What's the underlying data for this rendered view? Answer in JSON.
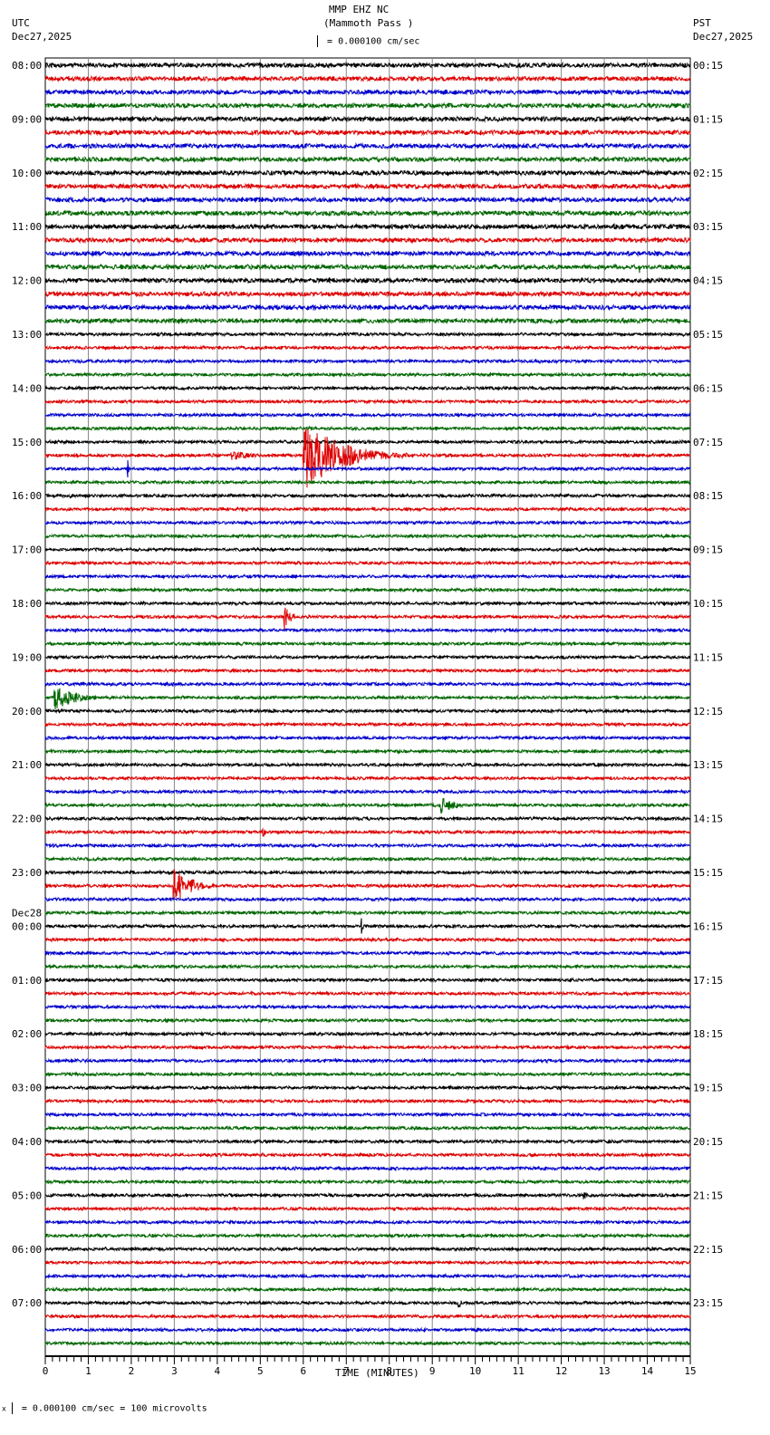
{
  "header": {
    "title": "MMP EHZ NC",
    "subtitle": "(Mammoth Pass )",
    "left_tz": "UTC",
    "left_date": "Dec27,2025",
    "right_tz": "PST",
    "right_date": "Dec27,2025",
    "scale_text": "= 0.000100 cm/sec"
  },
  "footer": {
    "scale_text": "= 0.000100 cm/sec =     100 microvolts"
  },
  "chart_data": {
    "type": "line",
    "title": "MMP EHZ NC (Mammoth Pass )",
    "xlabel": "TIME (MINUTES)",
    "xlim": [
      0,
      15
    ],
    "x_ticks": [
      "0",
      "1",
      "2",
      "3",
      "4",
      "5",
      "6",
      "7",
      "8",
      "9",
      "10",
      "11",
      "12",
      "13",
      "14",
      "15"
    ],
    "trace_count": 96,
    "minutes_per_trace": 15,
    "trace_colors": [
      "#000000",
      "#dd0000",
      "#0000cc",
      "#006600"
    ],
    "left_labels": [
      "08:00",
      "09:00",
      "10:00",
      "11:00",
      "12:00",
      "13:00",
      "14:00",
      "15:00",
      "16:00",
      "17:00",
      "18:00",
      "19:00",
      "20:00",
      "21:00",
      "22:00",
      "23:00",
      "00:00",
      "01:00",
      "02:00",
      "03:00",
      "04:00",
      "05:00",
      "06:00",
      "07:00"
    ],
    "date_change_label": "Dec28",
    "right_labels": [
      "00:15",
      "01:15",
      "02:15",
      "03:15",
      "04:15",
      "05:15",
      "06:15",
      "07:15",
      "08:15",
      "09:15",
      "10:15",
      "11:15",
      "12:15",
      "13:15",
      "14:15",
      "15:15",
      "16:15",
      "17:15",
      "18:15",
      "19:15",
      "20:15",
      "21:15",
      "22:15",
      "23:15"
    ],
    "events": [
      {
        "trace": 15,
        "minute": 13.8,
        "amplitude": 18,
        "duration": 0.1
      },
      {
        "trace": 29,
        "minute": 4.3,
        "amplitude": 6,
        "duration": 1.5
      },
      {
        "trace": 29,
        "minute": 6.0,
        "amplitude": 40,
        "duration": 2.5
      },
      {
        "trace": 30,
        "minute": 1.9,
        "amplitude": 14,
        "duration": 0.1
      },
      {
        "trace": 41,
        "minute": 5.55,
        "amplitude": 20,
        "duration": 0.3
      },
      {
        "trace": 47,
        "minute": 0.2,
        "amplitude": 14,
        "duration": 1.6
      },
      {
        "trace": 55,
        "minute": 9.2,
        "amplitude": 10,
        "duration": 0.9
      },
      {
        "trace": 57,
        "minute": 5.05,
        "amplitude": 12,
        "duration": 0.1
      },
      {
        "trace": 61,
        "minute": 2.95,
        "amplitude": 22,
        "duration": 1.2
      },
      {
        "trace": 64,
        "minute": 7.35,
        "amplitude": 10,
        "duration": 0.1
      },
      {
        "trace": 84,
        "minute": 12.5,
        "amplitude": 7,
        "duration": 0.2
      },
      {
        "trace": 92,
        "minute": 9.6,
        "amplitude": 12,
        "duration": 0.1
      }
    ]
  }
}
